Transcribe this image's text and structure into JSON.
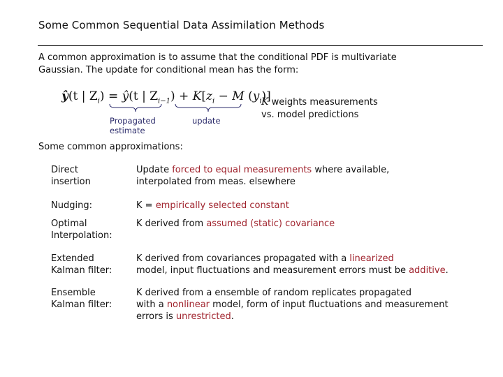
{
  "slide": {
    "title": "Some Common Sequential Data Assimilation Methods",
    "intro_line1": "A common approximation is to assume that the conditional PDF is multivariate",
    "intro_line2": "Gaussian.  The update for conditional mean has the form:",
    "formula": {
      "lhs_y": "ŷ",
      "lhs_arg_open": "(t | Z",
      "lhs_sub": "i",
      "lhs_arg_close": ")",
      "equals": " = ",
      "prop_y": "ŷ",
      "prop_arg_open": "(t | Z",
      "prop_sub": "i−1",
      "prop_arg_close": ")",
      "plus": " + ",
      "gain": "K",
      "bracket_open": "[",
      "z": "z",
      "z_sub": "i",
      "minus": " − ",
      "model": "M",
      "model_open": " (",
      "y": "y",
      "y_sub": "i",
      "model_close": ")]"
    },
    "brace_labels": {
      "propagated_line1": "Propagated",
      "propagated_line2": "estimate",
      "update": "update"
    },
    "k_note": {
      "k_symbol": "K",
      "line1_rest": " weights measurements",
      "line2": "vs. model predictions"
    },
    "approximations_heading": "Some common approximations:",
    "highlight_color": "#a0232d",
    "methods": [
      {
        "name_line1": "Direct",
        "name_line2": "insertion",
        "desc": [
          [
            {
              "t": "Update ",
              "hl": false
            },
            {
              "t": "forced to equal measurements",
              "hl": true
            },
            {
              "t": " where available,",
              "hl": false
            }
          ],
          [
            {
              "t": "interpolated from meas. elsewhere",
              "hl": false
            }
          ]
        ]
      },
      {
        "name_line1": "Nudging:",
        "name_line2": "",
        "desc": [
          [
            {
              "t": "K = ",
              "hl": false
            },
            {
              "t": "empirically selected constant",
              "hl": true
            }
          ]
        ]
      },
      {
        "name_line1": "Optimal",
        "name_line2": "Interpolation:",
        "desc": [
          [
            {
              "t": "K derived from ",
              "hl": false
            },
            {
              "t": "assumed (static) covariance",
              "hl": true
            }
          ]
        ]
      },
      {
        "name_line1": "Extended",
        "name_line2": "Kalman filter:",
        "desc": [
          [
            {
              "t": "K derived from covariances propagated with a ",
              "hl": false
            },
            {
              "t": "linearized",
              "hl": true
            }
          ],
          [
            {
              "t": "model, input fluctuations and measurement errors must be ",
              "hl": false
            },
            {
              "t": "additive",
              "hl": true
            },
            {
              "t": ".",
              "hl": false
            }
          ]
        ]
      },
      {
        "name_line1": "Ensemble",
        "name_line2": "Kalman filter:",
        "desc": [
          [
            {
              "t": "K derived from a ensemble of random replicates propagated",
              "hl": false
            }
          ],
          [
            {
              "t": "with a ",
              "hl": false
            },
            {
              "t": "nonlinear",
              "hl": true
            },
            {
              "t": " model, form of input fluctuations and measurement",
              "hl": false
            }
          ],
          [
            {
              "t": "errors is ",
              "hl": false
            },
            {
              "t": "unrestricted",
              "hl": true
            },
            {
              "t": ".",
              "hl": false
            }
          ]
        ]
      }
    ]
  }
}
